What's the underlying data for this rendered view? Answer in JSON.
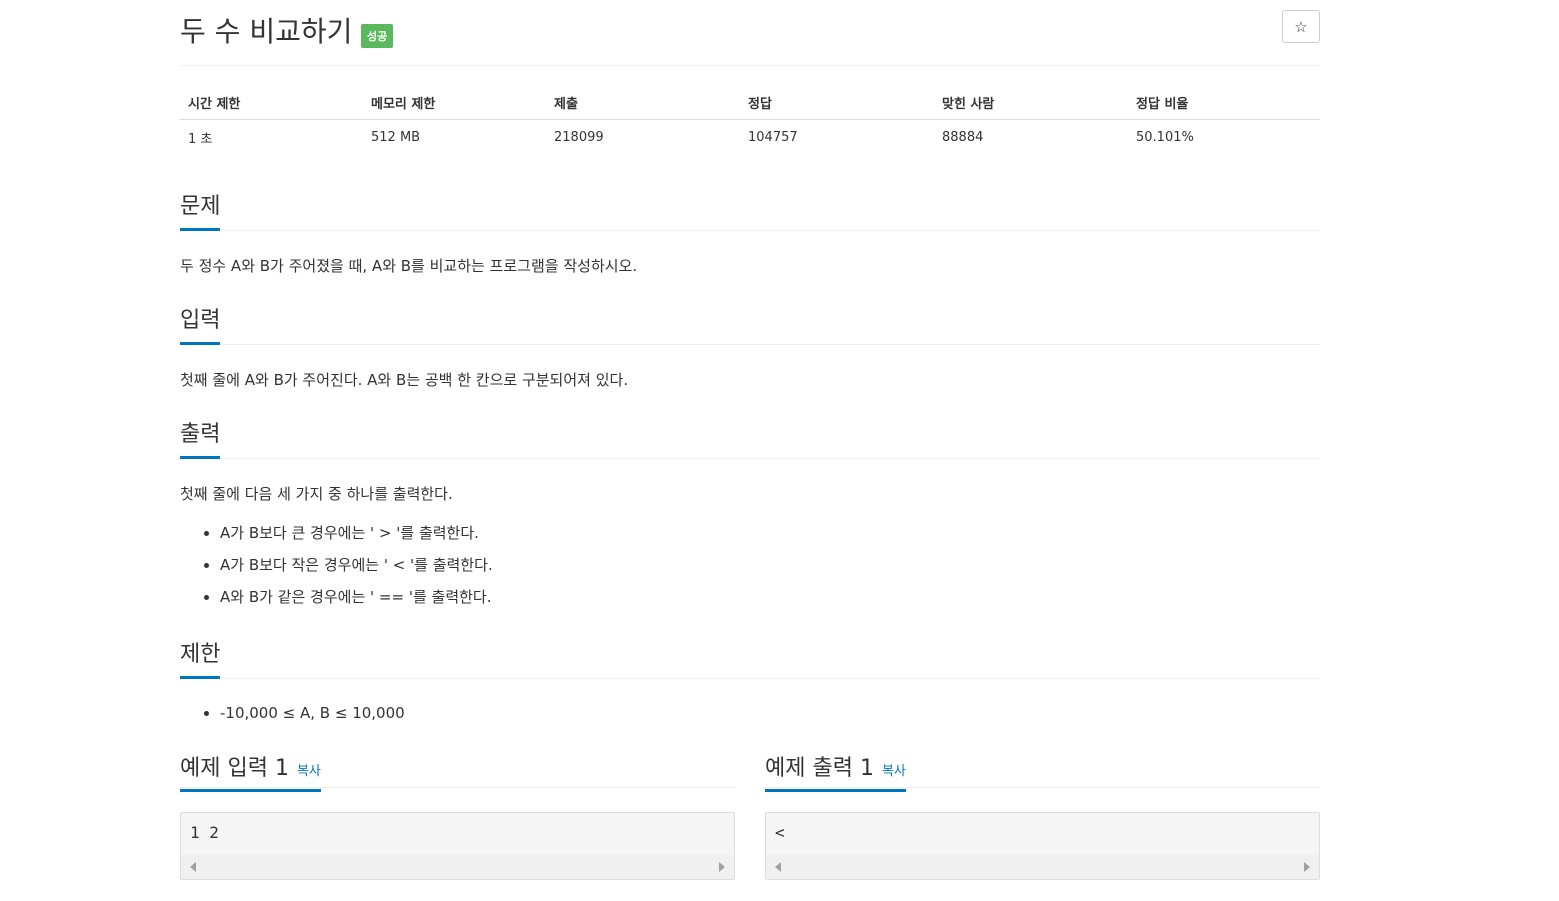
{
  "problem": {
    "title": "두 수 비교하기",
    "badge": "성공",
    "star": "☆"
  },
  "info_table": {
    "headers": [
      "시간 제한",
      "메모리 제한",
      "제출",
      "정답",
      "맞힌 사람",
      "정답 비율"
    ],
    "values": [
      "1 초",
      "512 MB",
      "218099",
      "104757",
      "88884",
      "50.101%"
    ]
  },
  "sections": {
    "description": {
      "title": "문제",
      "text": "두 정수 A와 B가 주어졌을 때, A와 B를 비교하는 프로그램을 작성하시오."
    },
    "input": {
      "title": "입력",
      "text": "첫째 줄에 A와 B가 주어진다. A와 B는 공백 한 칸으로 구분되어져 있다."
    },
    "output": {
      "title": "출력",
      "text": "첫째 줄에 다음 세 가지 중 하나를 출력한다.",
      "items": [
        "A가 B보다 큰 경우에는 ' > '를 출력한다.",
        "A가 B보다 작은 경우에는 ' < '를 출력한다.",
        "A와 B가 같은 경우에는 ' == '를 출력한다."
      ]
    },
    "limit": {
      "title": "제한",
      "items": [
        "-10,000 ≤ A, B ≤ 10,000"
      ]
    }
  },
  "samples": {
    "input": {
      "title": "예제 입력 1",
      "copy_label": "복사",
      "content": "1 2"
    },
    "output": {
      "title": "예제 출력 1",
      "copy_label": "복사",
      "content": "<"
    }
  },
  "colors": {
    "badge_bg": "#5cb85c",
    "accent": "#0076c0"
  }
}
